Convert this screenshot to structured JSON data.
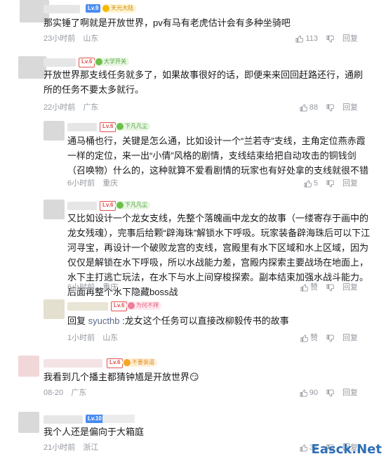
{
  "comments": [
    {
      "level": "Lv.9",
      "medal": "天元大陆",
      "text": "那实锤了啊就是开放世界，pv有马有老虎估计会有多种坐骑吧",
      "time": "23小时前",
      "location": "山东",
      "likes": "113",
      "reply_label": "回复"
    },
    {
      "level": "Lv.6",
      "medal": "大学开关",
      "text": "开放世界那支线任务就多了，如果故事很好的话，即便来来回回赶路还行，通刷所的任务不要太多就行。",
      "time": "22小时前",
      "location": "广东",
      "likes": "88",
      "reply_label": "回复"
    },
    {
      "level": "Lv.6",
      "medal": "下凡凡尘",
      "text": "通马桶也行，关键是怎么通，比如设计一个“兰若寺”支线，主角定位燕赤霞一样的定位，来一出“小倩”风格的剧情，支线结束给把自动攻击的铜钱剑（召唤物）什么的，这种就算不爱看剧情的玩家也有好处拿的支线就很不错",
      "time": "6小时前",
      "location": "重庆",
      "likes": "5",
      "reply_label": "回复"
    },
    {
      "level": "Lv.6",
      "medal": "下凡凡尘",
      "text": "又比如设计一个龙女支线，先整个落魄画中龙女的故事（一缕寄存于画中的龙女残魂），完事后给颗“辟海珠”解锁水下呼吸。玩家装备辟海珠后可以下江河寻宝，再设计一个破败龙宫的支线，宫殿里有水下区域和水上区域，因为仅仅是解锁在水下呼吸，所以水战能力差，宫殿内探索主要战场在地面上，水下主打逃亡玩法，在水下与水上间穿梭探索。副本结束加强水战斗能力。后面再整个水下隐藏boss战",
      "time": "6小时前",
      "location": "重庆",
      "likes_label": "赞",
      "reply_label": "回复"
    },
    {
      "level": "Lv.6",
      "medal": "为何不拜",
      "reply_prefix": "回复 ",
      "reply_to": "syucthb",
      "text": " :龙女这个任务可以直接改柳毅传书的故事",
      "time": "1小时前",
      "location": "山东",
      "likes_label": "赞",
      "reply_label": "回复"
    },
    {
      "level": "Lv.6",
      "medal": "不要装逼",
      "text": "我看到几个播主都猜钟馗是开放世界",
      "emoji": "😏",
      "time": "08-20",
      "location": "广东",
      "likes": "90",
      "reply_label": "回复"
    },
    {
      "level": "Lv.10",
      "text": "我个人还是偏向于大箱庭",
      "time": "21小时前",
      "location": "浙江",
      "likes": "31",
      "reply_label": "回复"
    }
  ],
  "watermark": "Easck.Net",
  "colors": {
    "level_blue": "#4a8cf0",
    "level_red": "#e0524f",
    "meta_gray": "#9499a0",
    "reply_link": "#5b6a8a"
  }
}
